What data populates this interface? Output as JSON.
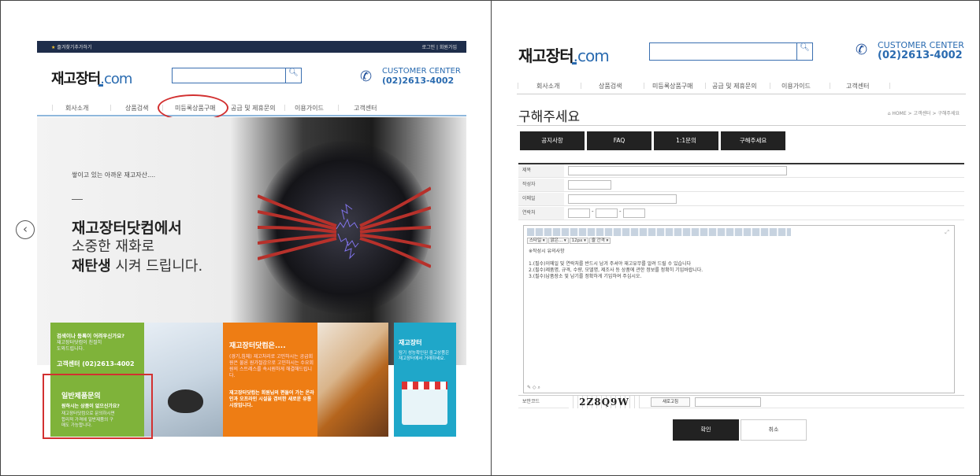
{
  "left": {
    "topbar": {
      "favorite": "즐겨찾기추가하기",
      "login": "로그인 | 회원가입"
    },
    "logo": {
      "main": "재고장터",
      "domain": ".com"
    },
    "customer_center": {
      "line1": "CUSTOMER CENTER",
      "line2": "(02)2613-4002"
    },
    "nav": [
      "회사소개",
      "상품검색",
      "미등록상품구매",
      "공급 및 제휴문의",
      "이용가이드",
      "고객센터"
    ],
    "hero": {
      "tagline": "쌓이고 있는 아까운 재고자산....",
      "headline1": "재고장터닷컴에서",
      "headline2": "소중한 재화로",
      "headline3_bold": "재탄생",
      "headline3_rest": " 시켜 드립니다."
    },
    "prev_arrow": "‹",
    "green_card": {
      "heading": "검색이나 등록이 어려우신가요?",
      "sub": "재고장터닷컴이 친절히 도와드립니다.",
      "tel": "고객센터 (02)2613-4002",
      "heading2": "일반제품문의",
      "sub2": "원하시는 상품이 없으신가요?",
      "sub3": "재고장터닷컴으로 문의하시면 합리적 가격에 일반제품의 구매도 가능합니다."
    },
    "orange_card": {
      "heading": "재고장터닷컴은....",
      "body": "(경기,침체) 재고처리로 고민하시는 공급회원은 물론 원가절감으로 고민하시는 수요회원의 스트레스를 속시원하게 해결해드립니다.",
      "body2": "재고장터닷컴는 회원님의 편들어 가는 온라인과 오프라인 시설을 겸비한 새로운 유통시장입니다."
    },
    "teal_card": {
      "heading": "재고장터",
      "body": "탐기 성능확인된 중고상품은 재고장터에서 거래하세요."
    }
  },
  "right": {
    "logo": {
      "main": "재고장터",
      "domain": ".com"
    },
    "customer_center": {
      "line1": "CUSTOMER CENTER",
      "line2": "(02)2613-4002"
    },
    "nav": [
      "회사소개",
      "상품검색",
      "미등록상품구매",
      "공급 및 제휴문의",
      "이용가이드",
      "고객센터"
    ],
    "page_title": "구해주세요",
    "breadcrumb": "⌂ HOME  >  고객센터  >  구해주세요",
    "tabs": [
      "공지사항",
      "FAQ",
      "1:1문의",
      "구해주세요"
    ],
    "form": {
      "labels": [
        "제목",
        "작성자",
        "이메일",
        "연락처"
      ],
      "toolbar_items": [
        "스타일 ▾",
        "맑은... ▾",
        "12px ▾",
        "줄 간격 ▾"
      ],
      "editor_body": [
        "※작성시 유의사항",
        "",
        "1.(필수)이메일 및 연락처를 반드시 남겨 주셔야 재고유무를 알려 드릴 수 있습니다",
        "2.(필수)제품명, 규격, 수량, 모델명, 제조사 등 상품에 관한 정보를 정확히 기입바랍니다.",
        "3.(필수)납품장소 및 납기를 정확하게 기입하여 주십시오."
      ],
      "captcha_label": "보안코드",
      "captcha_code": "2Z8Q9W",
      "refresh_label": "새로고침"
    },
    "buttons": {
      "ok": "확인",
      "cancel": "취소"
    }
  },
  "colors": {
    "brand_blue": "#2a6bb0",
    "highlight_red": "#d23030",
    "green": "#7fb33a",
    "orange": "#ee7d14",
    "teal": "#1fa7c9"
  }
}
